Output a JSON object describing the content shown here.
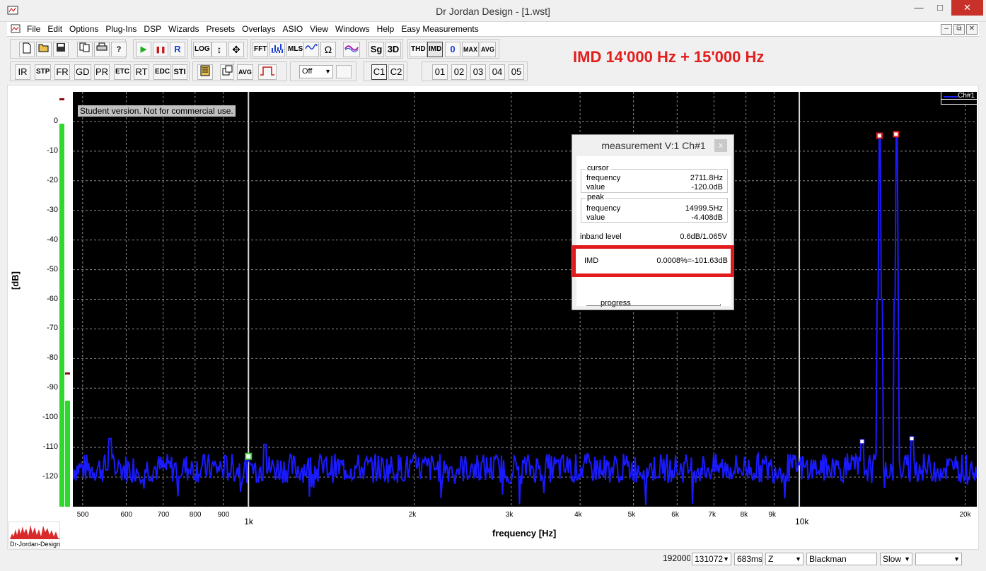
{
  "window": {
    "title": "Dr Jordan Design - [1.wst]",
    "minimize": "—",
    "maximize": "□",
    "close": "✕"
  },
  "menu": [
    "File",
    "Edit",
    "Options",
    "Plug-Ins",
    "DSP",
    "Wizards",
    "Presets",
    "Overlays",
    "ASIO",
    "View",
    "Windows",
    "Help",
    "Easy Measurements"
  ],
  "mdi_buttons": [
    "–",
    "⧉",
    "✕"
  ],
  "toolbar": {
    "row1": [
      "",
      "",
      "",
      "",
      "",
      "?",
      "▶",
      "❚❚",
      "R",
      "LOG",
      "↕",
      "✥",
      "FFT",
      "",
      "MLS",
      "",
      "Ω",
      "",
      "Sg",
      "3D",
      "THD",
      "IMD",
      "0",
      "MAX",
      "AVG"
    ],
    "row2": [
      "IR",
      "STP",
      "FR",
      "GD",
      "PR",
      "ETC",
      "RT",
      "EDC",
      "STI",
      "",
      "",
      "AVG",
      ""
    ],
    "select_value": "Off",
    "channels": [
      "C1",
      "C2"
    ],
    "presets": [
      "01",
      "02",
      "03",
      "04",
      "05"
    ]
  },
  "heading": "IMD   14'000 Hz + 15'000 Hz",
  "plot": {
    "watermark": "Student version. Not for commercial use.",
    "legend": "Ch#1",
    "y_unit": "[dB]",
    "x_label": "frequency [Hz]"
  },
  "chart_data": {
    "type": "line",
    "x_scale": "log",
    "xlim": [
      480,
      21000
    ],
    "ylim": [
      -130,
      10
    ],
    "yticks": [
      0,
      -10,
      -20,
      -30,
      -40,
      -50,
      -60,
      -70,
      -80,
      -90,
      -100,
      -110,
      -120
    ],
    "xticks_minor": [
      500,
      600,
      700,
      800,
      900,
      2000,
      3000,
      4000,
      5000,
      6000,
      7000,
      8000,
      9000,
      20000
    ],
    "xtick_labels_minor": [
      "500",
      "600",
      "700",
      "800",
      "900",
      "2k",
      "3k",
      "4k",
      "5k",
      "6k",
      "7k",
      "8k",
      "9k",
      "20k"
    ],
    "xticks_major": [
      1000,
      10000
    ],
    "xtick_labels_major": [
      "1k",
      "10k"
    ],
    "series": [
      {
        "color": "#1a1aff",
        "noise_floor_db": -117,
        "peaks": [
          [
            14000,
            -4.9
          ],
          [
            15000,
            -4.408
          ]
        ],
        "spurs": [
          [
            13000,
            -108
          ],
          [
            16000,
            -107
          ],
          [
            560,
            -107
          ],
          [
            1070,
            -109
          ]
        ]
      }
    ],
    "cursor_hz": 1000
  },
  "measurement": {
    "title": "measurement V:1 Ch#1",
    "close": "x",
    "cursor": {
      "legend": "cursor",
      "frequency_label": "frequency",
      "frequency": "2711.8Hz",
      "value_label": "value",
      "value": "-120.0dB"
    },
    "peak": {
      "legend": "peak",
      "frequency_label": "frequency",
      "frequency": "14999.5Hz",
      "value_label": "value",
      "value": "-4.408dB"
    },
    "inband": {
      "label": "inband level",
      "value": "0.6dB/1.065V"
    },
    "imd": {
      "label": "IMD",
      "value": "0.0008%=-101.63dB"
    },
    "progress": "progress"
  },
  "logo_text": "Dr-Jordan-Design",
  "status": {
    "rate": "192000",
    "fft": "131072",
    "time": "683ms",
    "weight": "Z",
    "window": "Blackman",
    "speed": "Slow",
    "extra": ""
  }
}
